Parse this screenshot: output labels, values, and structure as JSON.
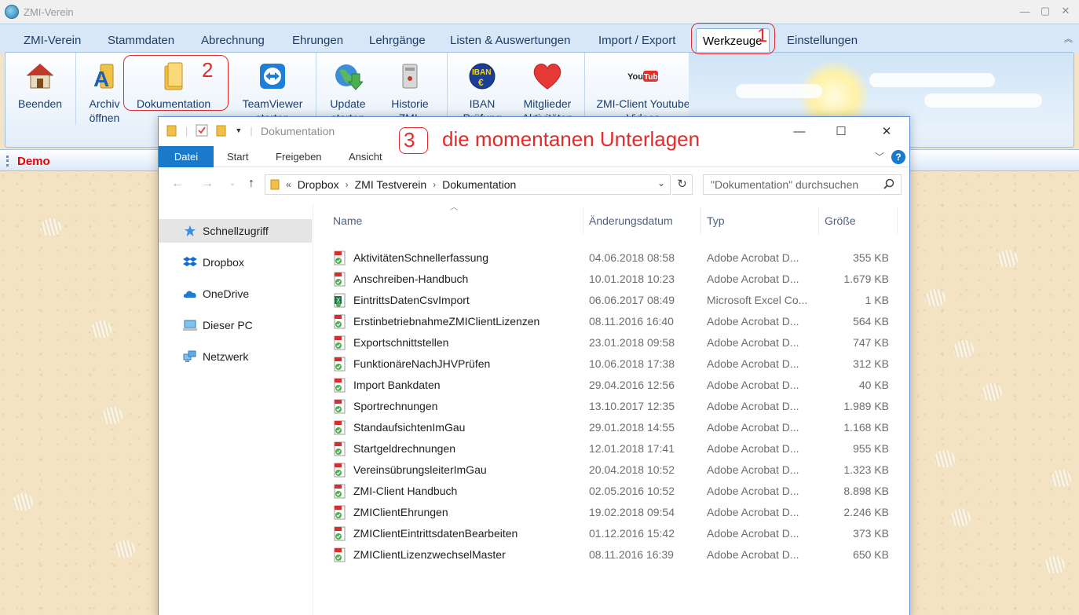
{
  "app": {
    "title": "ZMI-Verein",
    "menu": [
      {
        "id": "zmi-verein",
        "label": "ZMI-Verein"
      },
      {
        "id": "stammdaten",
        "label": "Stammdaten"
      },
      {
        "id": "abrechnung",
        "label": "Abrechnung"
      },
      {
        "id": "ehrungen",
        "label": "Ehrungen"
      },
      {
        "id": "lehrgaenge",
        "label": "Lehrgänge"
      },
      {
        "id": "listen",
        "label": "Listen & Auswertungen"
      },
      {
        "id": "import-export",
        "label": "Import / Export"
      },
      {
        "id": "werkzeuge",
        "label": "Werkzeuge"
      },
      {
        "id": "einstellungen",
        "label": "Einstellungen"
      }
    ],
    "active_menu": "Werkzeuge",
    "ribbon": [
      {
        "label": "Beenden",
        "icon": "house-icon"
      },
      {
        "label": "Archiv öffnen",
        "icon": "archive-icon"
      },
      {
        "label": "Dokumentation",
        "icon": "folder-icon"
      },
      {
        "label": "TeamViewer starten",
        "icon": "teamviewer-icon"
      },
      {
        "label": "Update starten",
        "icon": "globe-update-icon"
      },
      {
        "label": "Historie ZMI-Client",
        "icon": "history-icon"
      },
      {
        "label": "IBAN Prüfung",
        "icon": "iban-icon"
      },
      {
        "label": "Mitglieder Aktivitäten",
        "icon": "heart-icon"
      },
      {
        "label": "ZMI-Client Youtube Videos",
        "icon": "youtube-icon"
      }
    ],
    "status": "Demo"
  },
  "annotations": {
    "one": "1",
    "two": "2",
    "three": "3",
    "caption": "die momentanen Unterlagen",
    "color": "#e32b2b"
  },
  "explorer": {
    "title": "Dokumentation",
    "tabs": [
      "Datei",
      "Start",
      "Freigeben",
      "Ansicht"
    ],
    "address": {
      "prefix": "«",
      "parts": [
        "Dropbox",
        "ZMI Testverein",
        "Dokumentation"
      ]
    },
    "search_placeholder": "\"Dokumentation\" durchsuchen",
    "sidebar": [
      {
        "label": "Schnellzugriff",
        "icon": "star-icon"
      },
      {
        "label": "Dropbox",
        "icon": "dropbox-icon"
      },
      {
        "label": "OneDrive",
        "icon": "onedrive-icon"
      },
      {
        "label": "Dieser PC",
        "icon": "pc-icon"
      },
      {
        "label": "Netzwerk",
        "icon": "network-icon"
      }
    ],
    "columns": {
      "name": "Name",
      "date": "Änderungsdatum",
      "type": "Typ",
      "size": "Größe"
    },
    "files": [
      {
        "name": "AktivitätenSchnellerfassung",
        "date": "04.06.2018 08:58",
        "type": "Adobe Acrobat D...",
        "size": "355 KB",
        "kind": "pdf"
      },
      {
        "name": "Anschreiben-Handbuch",
        "date": "10.01.2018 10:23",
        "type": "Adobe Acrobat D...",
        "size": "1.679 KB",
        "kind": "pdf"
      },
      {
        "name": "EintrittsDatenCsvImport",
        "date": "06.06.2017 08:49",
        "type": "Microsoft Excel Co...",
        "size": "1 KB",
        "kind": "excel"
      },
      {
        "name": "ErstinbetriebnahmeZMIClientLizenzen",
        "date": "08.11.2016 16:40",
        "type": "Adobe Acrobat D...",
        "size": "564 KB",
        "kind": "pdf"
      },
      {
        "name": "Exportschnittstellen",
        "date": "23.01.2018 09:58",
        "type": "Adobe Acrobat D...",
        "size": "747 KB",
        "kind": "pdf"
      },
      {
        "name": "FunktionäreNachJHVPrüfen",
        "date": "10.06.2018 17:38",
        "type": "Adobe Acrobat D...",
        "size": "312 KB",
        "kind": "pdf"
      },
      {
        "name": "Import Bankdaten",
        "date": "29.04.2016 12:56",
        "type": "Adobe Acrobat D...",
        "size": "40 KB",
        "kind": "pdf"
      },
      {
        "name": "Sportrechnungen",
        "date": "13.10.2017 12:35",
        "type": "Adobe Acrobat D...",
        "size": "1.989 KB",
        "kind": "pdf"
      },
      {
        "name": "StandaufsichtenImGau",
        "date": "29.01.2018 14:55",
        "type": "Adobe Acrobat D...",
        "size": "1.168 KB",
        "kind": "pdf"
      },
      {
        "name": "Startgeldrechnungen",
        "date": "12.01.2018 17:41",
        "type": "Adobe Acrobat D...",
        "size": "955 KB",
        "kind": "pdf"
      },
      {
        "name": "VereinsübrungsleiterImGau",
        "date": "20.04.2018 10:52",
        "type": "Adobe Acrobat D...",
        "size": "1.323 KB",
        "kind": "pdf"
      },
      {
        "name": "ZMI-Client Handbuch",
        "date": "02.05.2016 10:52",
        "type": "Adobe Acrobat D...",
        "size": "8.898 KB",
        "kind": "pdf"
      },
      {
        "name": "ZMIClientEhrungen",
        "date": "19.02.2018 09:54",
        "type": "Adobe Acrobat D...",
        "size": "2.246 KB",
        "kind": "pdf"
      },
      {
        "name": "ZMIClientEintrittsdatenBearbeiten",
        "date": "01.12.2016 15:42",
        "type": "Adobe Acrobat D...",
        "size": "373 KB",
        "kind": "pdf"
      },
      {
        "name": "ZMIClientLizenzwechselMaster",
        "date": "08.11.2016 16:39",
        "type": "Adobe Acrobat D...",
        "size": "650 KB",
        "kind": "pdf"
      }
    ]
  }
}
